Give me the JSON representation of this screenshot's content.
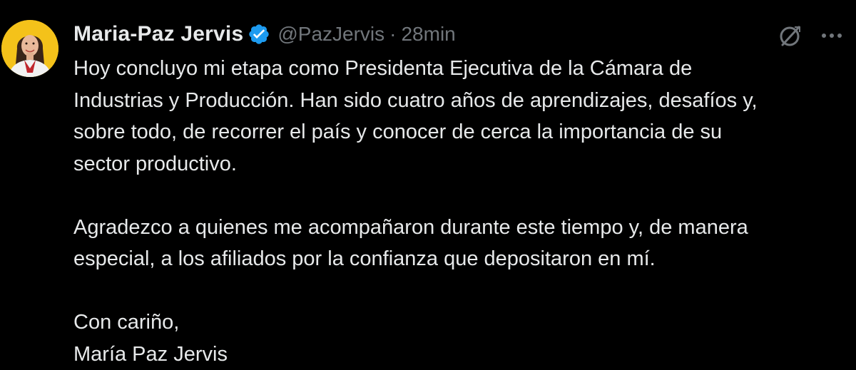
{
  "tweet": {
    "author": {
      "display_name": "Maria-Paz Jervis",
      "handle": "@PazJervis",
      "verified": true,
      "avatar_icon": "profile-photo"
    },
    "separator": "·",
    "timestamp": "28min",
    "actions": {
      "grok_icon": "grok-icon",
      "more_icon": "more-options-icon"
    },
    "body": {
      "paragraph1": [
        "Hoy concluyo mi etapa como Presidenta Ejecutiva de la Cámara de",
        "Industrias y Producción. Han sido cuatro años de aprendizajes, desafíos y,",
        "sobre todo, de recorrer el país y conocer de cerca la importancia de su",
        "sector productivo."
      ],
      "paragraph2": [
        "Agradezco a quienes me acompañaron durante este tiempo y, de manera",
        "especial, a los afiliados por la confianza que depositaron en mí."
      ],
      "paragraph3": [
        "Con cariño,",
        "María Paz Jervis"
      ]
    }
  },
  "colors": {
    "background": "#000000",
    "text_primary": "#e7e9ea",
    "text_secondary": "#71767b",
    "verified_blue": "#1d9bf0",
    "avatar_bg": "#f4c21a"
  }
}
